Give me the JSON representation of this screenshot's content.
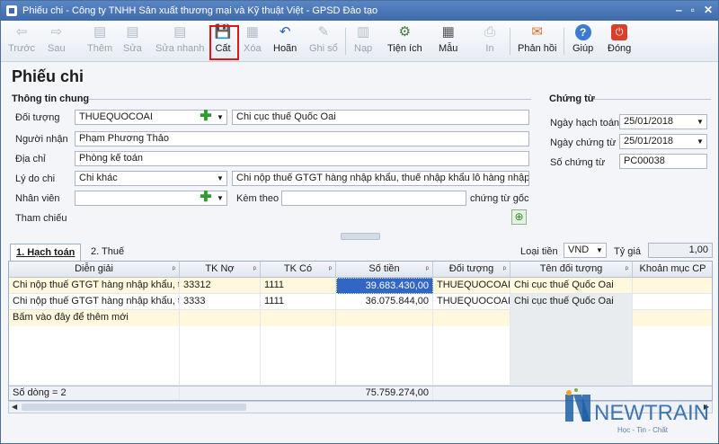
{
  "window": {
    "title": "Phiếu chi - Công ty TNHH Sản xuất thương mại và Kỹ thuật Việt - GPSD Đào tạo",
    "buttons": [
      "‒",
      "▫",
      "✕"
    ]
  },
  "toolbar": [
    {
      "label": "Trước",
      "icon": "arrow-left-icon",
      "glyph": "⇦",
      "enabled": false
    },
    {
      "label": "Sau",
      "icon": "arrow-right-icon",
      "glyph": "⇨",
      "enabled": false
    },
    {
      "label": "Thêm",
      "icon": "add-doc-icon",
      "glyph": "▤",
      "enabled": false
    },
    {
      "label": "Sửa",
      "icon": "edit-doc-icon",
      "glyph": "▤",
      "enabled": false
    },
    {
      "label": "Sửa nhanh",
      "icon": "quick-edit-icon",
      "glyph": "▤",
      "enabled": false
    },
    {
      "label": "Cất",
      "icon": "save-icon",
      "glyph": "💾",
      "enabled": true
    },
    {
      "label": "Xóa",
      "icon": "delete-icon",
      "glyph": "▦",
      "enabled": false
    },
    {
      "label": "Hoãn",
      "icon": "undo-icon",
      "glyph": "↶",
      "enabled": true
    },
    {
      "label": "Ghi sổ",
      "icon": "pencil-icon",
      "glyph": "✎",
      "enabled": false
    },
    {
      "label": "Nạp",
      "icon": "reload-icon",
      "glyph": "▥",
      "enabled": false
    },
    {
      "label": "Tiện ích",
      "icon": "utilities-icon",
      "glyph": "⚙",
      "enabled": true
    },
    {
      "label": "Mẫu",
      "icon": "template-icon",
      "glyph": "▦",
      "enabled": true
    },
    {
      "label": "In",
      "icon": "print-icon",
      "glyph": "⎙",
      "enabled": false
    },
    {
      "label": "Phản hồi",
      "icon": "feedback-icon",
      "glyph": "✉",
      "enabled": true
    },
    {
      "label": "Giúp",
      "icon": "help-icon",
      "glyph": "?",
      "enabled": true
    },
    {
      "label": "Đóng",
      "icon": "close-icon",
      "glyph": "⏻",
      "enabled": true
    }
  ],
  "page_title": "Phiếu chi",
  "general": {
    "title": "Thông tin chung",
    "doi_tuong": {
      "label": "Đối tượng",
      "code": "THUEQUOCOAI",
      "name": "Chi cục thuế Quốc Oai"
    },
    "nguoi_nhan": {
      "label": "Người nhận",
      "value": "Phạm Phương Thảo"
    },
    "dia_chi": {
      "label": "Địa chỉ",
      "value": "Phòng kế toán"
    },
    "ly_do": {
      "label": "Lý do chi",
      "value": "Chi khác",
      "desc": "Chi nộp thuế GTGT hàng nhập khẩu, thuế nhập khẩu lô hàng nhập khẩ"
    },
    "nhan_vien": {
      "label": "Nhân viên",
      "value": ""
    },
    "kem_theo": {
      "label": "Kèm theo",
      "value": "",
      "suffix": "chứng từ gốc"
    },
    "tham_chieu": {
      "label": "Tham chiếu"
    }
  },
  "voucher": {
    "title": "Chứng từ",
    "ngay_hach_toan": {
      "label": "Ngày hạch toán",
      "value": "25/01/2018"
    },
    "ngay_chung_tu": {
      "label": "Ngày chứng từ",
      "value": "25/01/2018"
    },
    "so_chung_tu": {
      "label": "Số chứng từ",
      "value": "PC00038"
    }
  },
  "tabs": [
    {
      "label": "1. Hạch toán",
      "active": true
    },
    {
      "label": "2. Thuế",
      "active": false
    }
  ],
  "currency": {
    "label": "Loại tiền",
    "value": "VND",
    "rate_label": "Tỷ giá",
    "rate": "1,00"
  },
  "grid": {
    "columns": [
      "Diễn giải",
      "TK Nợ",
      "TK Có",
      "Số tiền",
      "Đối tượng",
      "Tên đối tượng",
      "Khoản mục CP"
    ],
    "rows": [
      [
        "Chi nộp thuế GTGT hàng nhập khẩu, th",
        "33312",
        "1111",
        "39.683.430,00",
        "THUEQUOCOAI",
        "Chi cục thuế Quốc Oai",
        ""
      ],
      [
        "Chi nộp thuế GTGT hàng nhập khẩu, th",
        "3333",
        "1111",
        "36.075.844,00",
        "THUEQUOCOAI",
        "Chi cục thuế Quốc Oai",
        ""
      ]
    ],
    "new_row_hint": "Bấm vào đây để thêm mới",
    "footer_count": "Số dòng = 2",
    "footer_total": "75.759.274,00"
  },
  "logo": {
    "text": "NEWTRAIN",
    "tagline": "Học - Tin - Chất",
    "color": "#1f5fa6"
  }
}
